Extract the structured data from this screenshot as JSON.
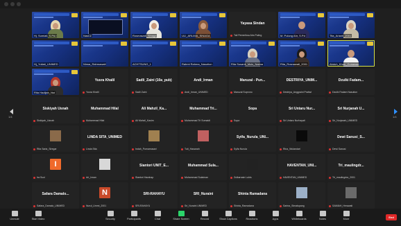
{
  "pager": {
    "left": "1/4",
    "right": "1/4"
  },
  "tiles": [
    {
      "kind": "video",
      "name": "Hj. Sumiati, S.Pd.I",
      "person": "hijab",
      "color": "#e5d7b0",
      "body": "#6b7b4a"
    },
    {
      "kind": "slide",
      "name": "Nasrul"
    },
    {
      "kind": "video",
      "name": "Rosmawati, Sinaga",
      "person": "hijab",
      "color": "#f0eee8",
      "body": "#e7e4dc"
    },
    {
      "kind": "video",
      "name": "ULI_ARLIMA_SINAGA",
      "person": "hijab",
      "color": "#8a5a3c",
      "body": "#7a4f36"
    },
    {
      "kind": "text",
      "big": "Yayasa Sindan",
      "small": "Tali Pemeriksa Abs Paling"
    },
    {
      "kind": "video",
      "name": "M. Pulung Ahr, S.Pd",
      "person": "man",
      "color": "#c99a7c",
      "body": "#2a2a5a"
    },
    {
      "kind": "video",
      "name": "Tita_Arianti_2001",
      "person": "hijab",
      "color": "#d9d3c4",
      "body": "#c4bba6"
    },
    {
      "kind": "video",
      "name": "Hj_Yuliati_UNIMED",
      "person": "none"
    },
    {
      "kind": "video",
      "name": "Nirwa_Rahmawati",
      "person": "none"
    },
    {
      "kind": "video",
      "name": "ACHTSUNG_1",
      "person": "none"
    },
    {
      "kind": "video",
      "name": "Rahmi Rahma_Nasution",
      "person": "none"
    },
    {
      "kind": "video",
      "name": "Rita Susanti_Muis_Naima",
      "person": "hijab",
      "color": "#d6d0c0",
      "body": "#6a7185"
    },
    {
      "kind": "video",
      "name": "Rita_Rosnawati_2001",
      "person": "hijab",
      "color": "#1b1b1b",
      "body": "#3a2f2a"
    },
    {
      "kind": "video",
      "name": "Abduh_Khan_Gunawan",
      "person": "man",
      "color": "#c99a7c",
      "body": "#f2f2f2",
      "active": true
    },
    {
      "kind": "video",
      "name": "Rita Hadijah_Nst",
      "person": "hijab",
      "color": "#b23a2e",
      "body": "#2d2d2d"
    },
    {
      "kind": "text",
      "big": "Yusra Khalil",
      "small": "Yusra Khalil"
    },
    {
      "kind": "text",
      "big": "Sadli_Zaini (10a_pub)",
      "small": "Sadli Zaini"
    },
    {
      "kind": "text",
      "big": "Andi_Irman",
      "small": "Andi_Irman_UNIMED"
    },
    {
      "kind": "text",
      "big": "Maruzal - Pun...",
      "small": "Maruzal Suprono"
    },
    {
      "kind": "text",
      "big": "DESTRIYA_UNIM...",
      "small": "Destriya_Anggraini Pratiwi"
    },
    {
      "kind": "text",
      "big": "Dzulki Fadam...",
      "small": "Dzulki Fadam Nasution"
    },
    {
      "kind": "text",
      "big": "Siskiyah Usnah",
      "small": "Siskiyah_Usnah"
    },
    {
      "kind": "text",
      "big": "Muhammad Hilal",
      "small": "Muhammad Hilal"
    },
    {
      "kind": "text",
      "big": "Ali Mahzil_Ka...",
      "small": "Ali Mahzil_Kasim"
    },
    {
      "kind": "text",
      "big": "Muhammad Tri...",
      "small": "Muhammad Tri Sumaidi"
    },
    {
      "kind": "text",
      "big": "Sopa",
      "small": "Sopa"
    },
    {
      "kind": "text",
      "big": "Sri Untaru Nur...",
      "small": "Sri Untaru Nurhayati"
    },
    {
      "kind": "text",
      "big": "Sri Nurjanah U...",
      "small": "Sri_Nurjanah_UNIMED"
    },
    {
      "kind": "avatar",
      "name": "Rita Saria_Siregar",
      "avatarColor": "#8a6a4a"
    },
    {
      "kind": "text",
      "big": "LINDA SITA_UNIMED",
      "small": "Linda Sita"
    },
    {
      "kind": "avatar",
      "name": "Indah_Purnamasari",
      "avatarColor": "#a08050"
    },
    {
      "kind": "avatar",
      "name": "Tuti_Hasanah",
      "avatarColor": "#c06060"
    },
    {
      "kind": "text",
      "big": "Syifa_Nurula_UNI...",
      "small": "Syifa Nurula"
    },
    {
      "kind": "avatar",
      "name": "Rina_Wulandari",
      "avatarColor": "#0a0a0a"
    },
    {
      "kind": "text",
      "big": "Dewi Sanusi_S...",
      "small": "Dewi Sanusi"
    },
    {
      "kind": "letter",
      "name": "Ira Suci",
      "letter": "I",
      "letterColor": "#f06a2b"
    },
    {
      "kind": "avatar",
      "name": "Ari_Irwan",
      "avatarColor": "#d8d8d8"
    },
    {
      "kind": "text",
      "big": "Siantori UNIT_E...",
      "small": "Siantori Harahap"
    },
    {
      "kind": "text",
      "big": "Muhammad Sula...",
      "small": "Muhammad Sulaiman"
    },
    {
      "kind": "avatar",
      "name": "Zulkarnain Lubis",
      "avatarColor": "#222222"
    },
    {
      "kind": "text",
      "big": "HAVENTAN_UNI...",
      "small": "HAVENTAN_UNIMED"
    },
    {
      "kind": "text",
      "big": "Tri_maulingdr...",
      "small": "Tri_maulingdra_2001"
    },
    {
      "kind": "text",
      "big": "Safara Damalo...",
      "small": "Safara_Damalo_UNIMED"
    },
    {
      "kind": "letter",
      "name": "Nurul_Ummi_2001",
      "letter": "N",
      "letterColor": "#c94a2a"
    },
    {
      "kind": "text",
      "big": "SRI-RAHAYU",
      "small": "SRI-RAHAYU"
    },
    {
      "kind": "text",
      "big": "SRI_Nuraini",
      "small": "Sri_Nuraini UNIMED"
    },
    {
      "kind": "text",
      "big": "Shinta Ramadana",
      "small": "Shinta_Ramadana"
    },
    {
      "kind": "avatar",
      "name": "Sarina_Simatupang",
      "avatarColor": "#9cb0c8"
    },
    {
      "kind": "avatar",
      "name": "SAMIAH_Herawati",
      "avatarColor": "#6a6a6a"
    }
  ],
  "toolbar": {
    "items": [
      {
        "label": "Unmute",
        "icon": "microphone-icon",
        "style": ""
      },
      {
        "label": "Start Video",
        "icon": "video-camera-icon",
        "style": ""
      },
      {
        "label": "Security",
        "icon": "shield-icon",
        "style": ""
      },
      {
        "label": "Participants",
        "icon": "participants-icon",
        "style": ""
      },
      {
        "label": "Chat",
        "icon": "chat-icon",
        "style": ""
      },
      {
        "label": "Share Screen",
        "icon": "share-screen-icon",
        "style": "green"
      },
      {
        "label": "Record",
        "icon": "record-icon",
        "style": ""
      },
      {
        "label": "Show Captions",
        "icon": "captions-icon",
        "style": ""
      },
      {
        "label": "Reactions",
        "icon": "reactions-icon",
        "style": ""
      },
      {
        "label": "Apps",
        "icon": "apps-icon",
        "style": ""
      },
      {
        "label": "Whiteboards",
        "icon": "whiteboard-icon",
        "style": ""
      },
      {
        "label": "Notes",
        "icon": "notes-icon",
        "style": ""
      },
      {
        "label": "More",
        "icon": "more-icon",
        "style": ""
      }
    ],
    "end_label": "End"
  },
  "colors": {
    "tileBg": "#232323",
    "videoBlue": "#1e3f9b",
    "activeBorder": "#d8e34a",
    "endRed": "#e02828"
  }
}
